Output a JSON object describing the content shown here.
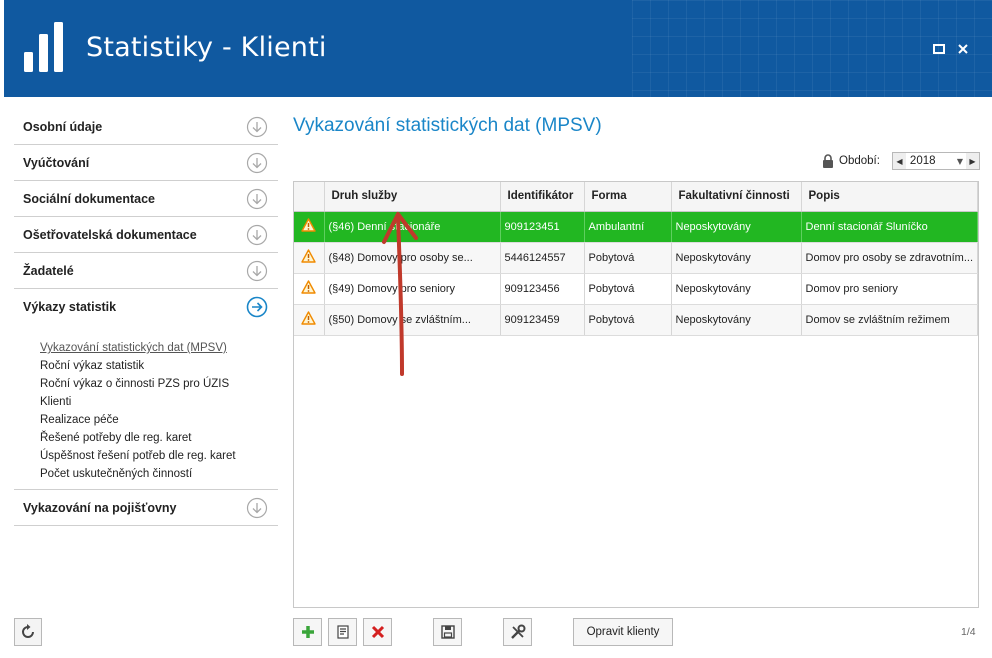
{
  "app": {
    "title": "Statistiky - Klienti"
  },
  "sidebar": {
    "items": [
      {
        "label": "Osobní údaje"
      },
      {
        "label": "Vyúčtování"
      },
      {
        "label": "Sociální dokumentace"
      },
      {
        "label": "Ošetřovatelská dokumentace"
      },
      {
        "label": "Žadatelé"
      },
      {
        "label": "Výkazy statistik"
      }
    ],
    "subitems": [
      {
        "label": "Vykazování statistických dat (MPSV)"
      },
      {
        "label": "Roční výkaz statistik"
      },
      {
        "label": "Roční výkaz o činnosti PZS pro ÚZIS"
      },
      {
        "label": "Klienti"
      },
      {
        "label": "Realizace péče"
      },
      {
        "label": "Řešené potřeby dle reg. karet"
      },
      {
        "label": "Úspěšnost řešení potřeb dle reg. karet"
      },
      {
        "label": "Počet uskutečněných činností"
      }
    ],
    "bottom_item": {
      "label": "Vykazování na pojišťovny"
    }
  },
  "main": {
    "title": "Vykazování statistických dat (MPSV)",
    "period": {
      "label": "Období:",
      "value": "2018"
    },
    "table": {
      "columns": [
        "Druh služby",
        "Identifikátor",
        "Forma",
        "Fakultativní činnosti",
        "Popis"
      ],
      "rows": [
        {
          "druh": "(§46) Denní stacionáře",
          "id": "909123451",
          "forma": "Ambulantní",
          "fakult": "Neposkytovány",
          "popis": "Denní stacionář Sluníčko"
        },
        {
          "druh": "(§48) Domovy pro osoby se...",
          "id": "5446124557",
          "forma": "Pobytová",
          "fakult": "Neposkytovány",
          "popis": "Domov pro osoby se zdravotním..."
        },
        {
          "druh": "(§49) Domovy pro seniory",
          "id": "909123456",
          "forma": "Pobytová",
          "fakult": "Neposkytovány",
          "popis": "Domov pro seniory"
        },
        {
          "druh": "(§50) Domovy se zvláštním...",
          "id": "909123459",
          "forma": "Pobytová",
          "fakult": "Neposkytovány",
          "popis": "Domov se zvláštním režimem"
        }
      ]
    }
  },
  "toolbar": {
    "fix_label": "Opravit klienty"
  },
  "pager": {
    "text": "1/4"
  },
  "colors": {
    "header": "#1059a0",
    "accent": "#1a86c8",
    "selected_row": "#22b722",
    "warning": "#f08a00"
  },
  "icons": [
    "logo-bars-icon",
    "maximize-icon",
    "close-icon",
    "chevron-down-circle-icon",
    "arrow-right-circle-icon",
    "lock-icon",
    "warning-icon",
    "refresh-icon",
    "add-icon",
    "edit-icon",
    "delete-icon",
    "save-icon",
    "tools-icon"
  ]
}
